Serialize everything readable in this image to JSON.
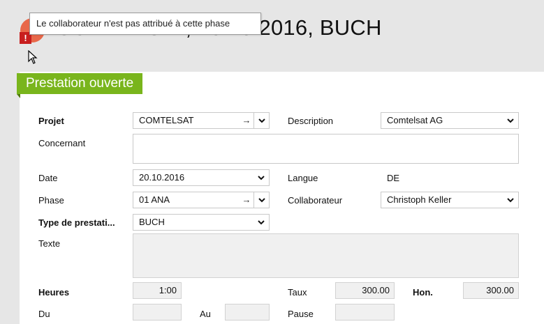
{
  "header": {
    "title": "COMTELSAT, 20.10.2016, BUCH",
    "tooltip": "Le collaborateur n'est pas attribué à cette phase",
    "warning_mark": "!"
  },
  "section": {
    "title": "Prestation ouverte"
  },
  "form": {
    "projet": {
      "label": "Projet",
      "value": "COMTELSAT",
      "arrow": "→"
    },
    "description": {
      "label": "Description",
      "value": "Comtelsat AG"
    },
    "concernant": {
      "label": "Concernant",
      "value": ""
    },
    "date": {
      "label": "Date",
      "value": "20.10.2016"
    },
    "langue": {
      "label": "Langue",
      "value": "DE"
    },
    "phase": {
      "label": "Phase",
      "value": "01 ANA",
      "arrow": "→"
    },
    "collaborateur": {
      "label": "Collaborateur",
      "value": "Christoph Keller"
    },
    "type_prestation": {
      "label": "Type de prestati...",
      "value": "BUCH"
    },
    "texte": {
      "label": "Texte",
      "value": ""
    },
    "heures": {
      "label": "Heures",
      "value": "1:00"
    },
    "taux": {
      "label": "Taux",
      "value": "300.00"
    },
    "hon": {
      "label": "Hon.",
      "value": "300.00"
    },
    "du": {
      "label": "Du",
      "value": ""
    },
    "au": {
      "label": "Au",
      "value": ""
    },
    "pause": {
      "label": "Pause",
      "value": ""
    }
  },
  "colors": {
    "accent": "#79b51c",
    "status": "#e8684a",
    "warning": "#c81e1e"
  }
}
